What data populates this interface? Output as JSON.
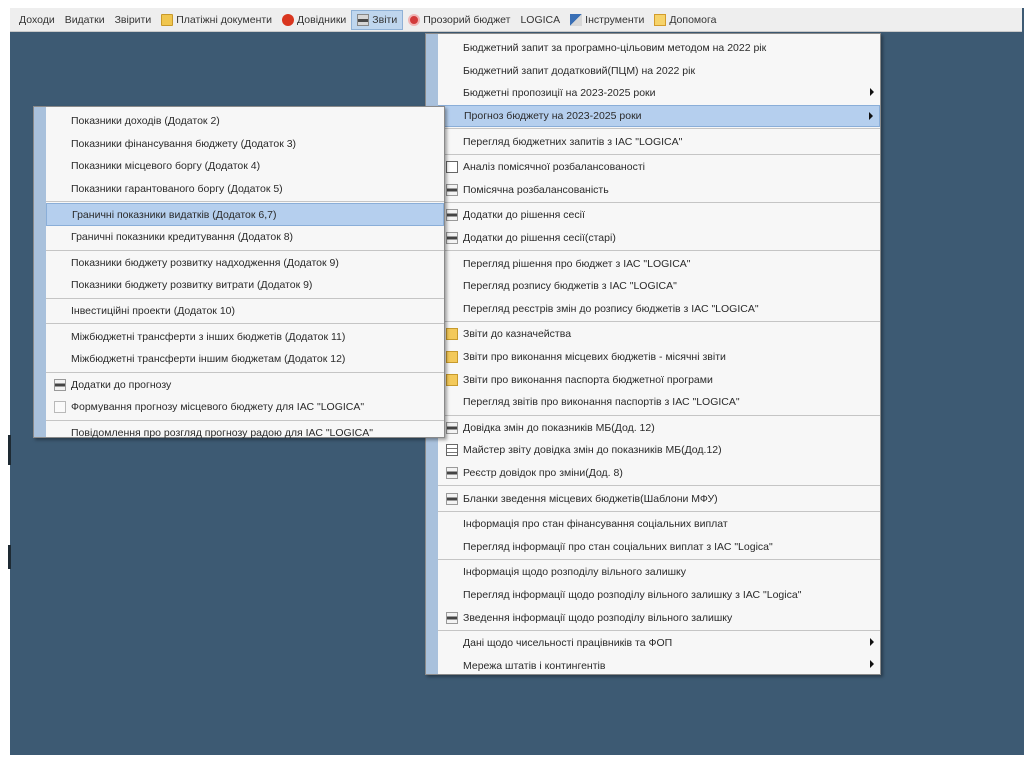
{
  "menubar": [
    {
      "label": "Доходи",
      "icon": "",
      "active": false
    },
    {
      "label": "Видатки",
      "icon": "",
      "active": false
    },
    {
      "label": "Звірити",
      "icon": "",
      "active": false
    },
    {
      "label": "Платіжні документи",
      "icon": "folder-icon",
      "active": false
    },
    {
      "label": "Довідники",
      "icon": "reference-icon",
      "active": false
    },
    {
      "label": "Звіти",
      "icon": "report-icon",
      "active": true
    },
    {
      "label": "Прозорий бюджет",
      "icon": "budget-icon",
      "active": false
    },
    {
      "label": "LOGICA",
      "icon": "",
      "active": false
    },
    {
      "label": "Інструменти",
      "icon": "tools-icon",
      "active": false
    },
    {
      "label": "Допомога",
      "icon": "help-icon",
      "active": false
    }
  ],
  "reports_menu": {
    "items": [
      {
        "label": "Бюджетний запит за програмно-цільовим методом на 2022 рік",
        "icon": "none",
        "submenu": false,
        "selected": false
      },
      {
        "label": "Бюджетний запит додатковий(ПЦМ) на 2022 рік",
        "icon": "none",
        "submenu": false,
        "selected": false
      },
      {
        "label": "Бюджетні пропозиції на 2023-2025 роки",
        "icon": "none",
        "submenu": true,
        "selected": false
      },
      {
        "label": "Прогноз бюджету на 2023-2025 роки",
        "icon": "none",
        "submenu": true,
        "selected": true
      },
      {
        "sep": true
      },
      {
        "label": "Перегляд бюджетних запитів з ІАС \"LOGICA\"",
        "icon": "none",
        "submenu": false,
        "selected": false
      },
      {
        "sep": true
      },
      {
        "label": "Аналіз помісячної розбалансованості",
        "icon": "sheet",
        "submenu": false,
        "selected": false
      },
      {
        "label": "Помісячна розбалансованість",
        "icon": "rep",
        "submenu": false,
        "selected": false
      },
      {
        "sep": true
      },
      {
        "label": "Додатки до рішення сесії",
        "icon": "rep",
        "submenu": false,
        "selected": false
      },
      {
        "label": "Додатки до рішення сесії(старі)",
        "icon": "rep",
        "submenu": false,
        "selected": false
      },
      {
        "sep": true
      },
      {
        "label": "Перегляд рішення про бюджет з ІАС \"LOGICA\"",
        "icon": "none",
        "submenu": false,
        "selected": false
      },
      {
        "label": "Перегляд розпису бюджетів з ІАС \"LOGICA\"",
        "icon": "none",
        "submenu": false,
        "selected": false
      },
      {
        "label": "Перегляд реєстрів змін до розпису бюджетів з ІАС \"LOGICA\"",
        "icon": "none",
        "submenu": false,
        "selected": false
      },
      {
        "sep": true
      },
      {
        "label": "Звіти до казначейства",
        "icon": "fold",
        "submenu": false,
        "selected": false
      },
      {
        "label": "Звіти про виконання місцевих бюджетів - місячні звіти",
        "icon": "fold",
        "submenu": false,
        "selected": false
      },
      {
        "label": "Звіти про виконання паспорта бюджетної програми",
        "icon": "fold",
        "submenu": false,
        "selected": false
      },
      {
        "label": "Перегляд звітів про виконання паспортів з ІАС \"LOGICA\"",
        "icon": "none",
        "submenu": false,
        "selected": false
      },
      {
        "sep": true
      },
      {
        "label": "Довідка змін до показників МБ(Дод. 12)",
        "icon": "rep",
        "submenu": false,
        "selected": false
      },
      {
        "label": "Майстер звіту довідка змін до показників МБ(Дод.12)",
        "icon": "tbl",
        "submenu": false,
        "selected": false
      },
      {
        "label": "Реєстр довідок про зміни(Дод. 8)",
        "icon": "rep",
        "submenu": false,
        "selected": false
      },
      {
        "sep": true
      },
      {
        "label": "Бланки зведення місцевих бюджетів(Шаблони МФУ)",
        "icon": "rep",
        "submenu": false,
        "selected": false
      },
      {
        "sep": true
      },
      {
        "label": "Інформація про стан фінансування соціальних виплат",
        "icon": "none",
        "submenu": false,
        "selected": false
      },
      {
        "label": "Перегляд інформації про стан соціальних виплат з ІАС \"Logica\"",
        "icon": "none",
        "submenu": false,
        "selected": false
      },
      {
        "sep": true
      },
      {
        "label": "Інформація щодо розподілу вільного залишку",
        "icon": "none",
        "submenu": false,
        "selected": false
      },
      {
        "label": "Перегляд інформації щодо розподілу вільного залишку з ІАС \"Logica\"",
        "icon": "none",
        "submenu": false,
        "selected": false
      },
      {
        "label": "Зведення інформації щодо розподілу вільного залишку",
        "icon": "rep",
        "submenu": false,
        "selected": false
      },
      {
        "sep": true
      },
      {
        "label": "Дані щодо чисельності працівників та ФОП",
        "icon": "none",
        "submenu": true,
        "selected": false
      },
      {
        "label": "Мережа штатів і контингентів",
        "icon": "none",
        "submenu": true,
        "selected": false
      }
    ]
  },
  "forecast_submenu": {
    "items": [
      {
        "label": "Показники доходів (Додаток 2)",
        "icon": "none",
        "selected": false
      },
      {
        "label": "Показники фінансування бюджету (Додаток 3)",
        "icon": "none",
        "selected": false
      },
      {
        "label": "Показники місцевого боргу (Додаток 4)",
        "icon": "none",
        "selected": false
      },
      {
        "label": "Показники гарантованого боргу (Додаток 5)",
        "icon": "none",
        "selected": false
      },
      {
        "sep": true
      },
      {
        "label": "Граничні показники видатків (Додаток 6,7)",
        "icon": "none",
        "selected": true
      },
      {
        "label": "Граничні показники кредитування (Додаток 8)",
        "icon": "none",
        "selected": false
      },
      {
        "sep": true
      },
      {
        "label": "Показники бюджету розвитку надходження (Додаток 9)",
        "icon": "none",
        "selected": false
      },
      {
        "label": "Показники бюджету розвитку витрати (Додаток 9)",
        "icon": "none",
        "selected": false
      },
      {
        "sep": true
      },
      {
        "label": "Інвестиційні проекти (Додаток 10)",
        "icon": "none",
        "selected": false
      },
      {
        "sep": true
      },
      {
        "label": "Міжбюджетні трансферти з інших бюджетів (Додаток 11)",
        "icon": "none",
        "selected": false
      },
      {
        "label": "Міжбюджетні трансферти іншим бюджетам (Додаток 12)",
        "icon": "none",
        "selected": false
      },
      {
        "sep": true
      },
      {
        "label": "Додатки до прогнозу",
        "icon": "rep",
        "selected": false
      },
      {
        "label": "Формування прогнозу місцевого бюджету для ІАС \"LOGICA\"",
        "icon": "doc",
        "selected": false
      },
      {
        "sep": true
      },
      {
        "label": "Повідомлення про розгляд прогнозу радою для ІАС \"LOGICA\"",
        "icon": "none",
        "selected": false
      }
    ]
  }
}
